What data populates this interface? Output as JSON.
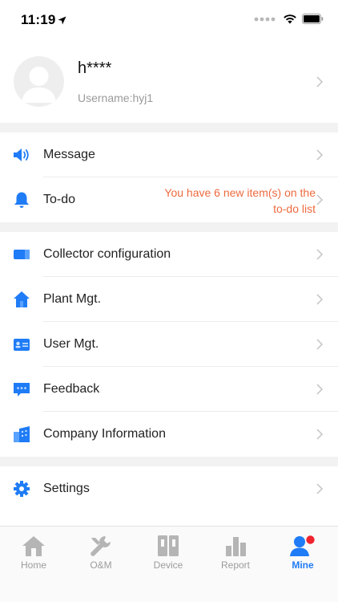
{
  "status_bar": {
    "time": "11:19"
  },
  "profile": {
    "name": "h****",
    "username": "Username:hyj1"
  },
  "menu_group_1": [
    {
      "label": "Message",
      "icon": "speaker-icon"
    },
    {
      "label": "To-do",
      "icon": "bell-icon",
      "note": "You have 6 new item(s) on the to-do list"
    }
  ],
  "menu_group_2": [
    {
      "label": "Collector configuration",
      "icon": "collector-icon"
    },
    {
      "label": "Plant Mgt.",
      "icon": "house-icon"
    },
    {
      "label": "User Mgt.",
      "icon": "id-card-icon"
    },
    {
      "label": "Feedback",
      "icon": "chat-bubble-icon"
    },
    {
      "label": "Company Information",
      "icon": "building-icon"
    }
  ],
  "menu_group_3": [
    {
      "label": "Settings",
      "icon": "gear-icon"
    }
  ],
  "tabbar": {
    "tabs": [
      {
        "label": "Home",
        "icon": "home-icon"
      },
      {
        "label": "O&M",
        "icon": "wrench-icon"
      },
      {
        "label": "Device",
        "icon": "device-icon"
      },
      {
        "label": "Report",
        "icon": "bar-chart-icon"
      },
      {
        "label": "Mine",
        "icon": "user-icon",
        "active": true
      }
    ]
  },
  "colors": {
    "accent": "#1f7cf6",
    "todo_note": "#ee6a3e",
    "notification_dot": "#f0242f",
    "inactive_tab": "#b5b5b5"
  }
}
